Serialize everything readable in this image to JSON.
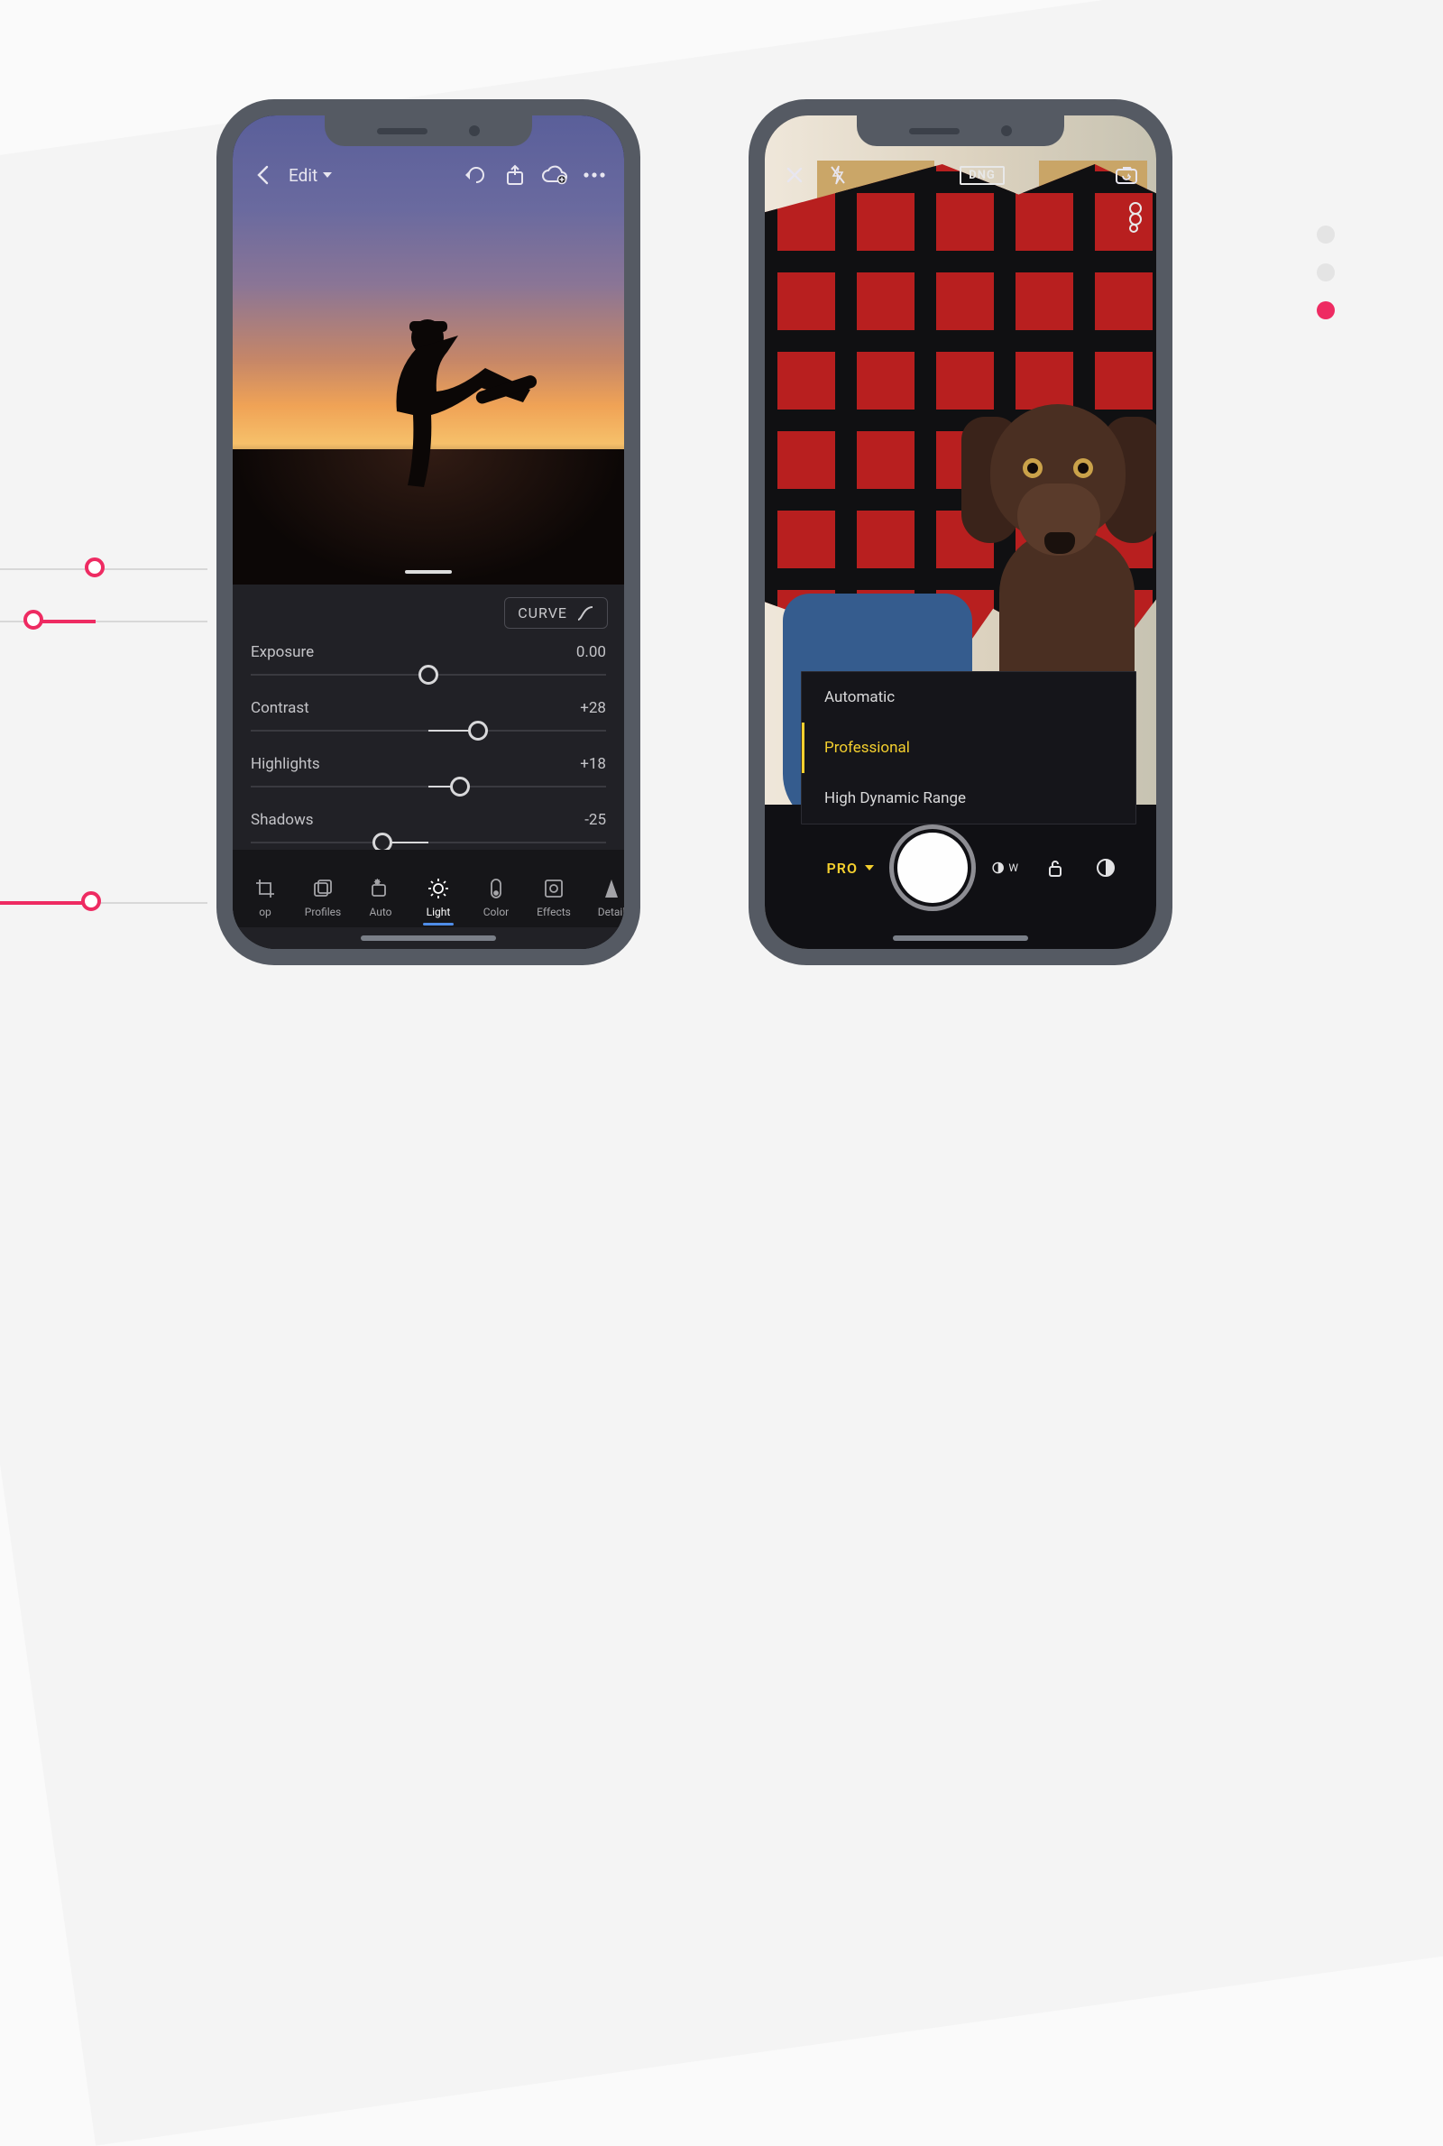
{
  "decoration": {
    "pager_dots": 3,
    "pager_active_index": 2
  },
  "editor": {
    "top": {
      "title": "Edit",
      "back_icon": "chevron-left",
      "actions": [
        "undo-icon",
        "share-icon",
        "cloud-add-icon",
        "more-icon"
      ]
    },
    "curve_button": "CURVE",
    "sliders": [
      {
        "label": "Exposure",
        "value_text": "0.00",
        "pos_pct": 50
      },
      {
        "label": "Contrast",
        "value_text": "+28",
        "pos_pct": 64
      },
      {
        "label": "Highlights",
        "value_text": "+18",
        "pos_pct": 59
      },
      {
        "label": "Shadows",
        "value_text": "-25",
        "pos_pct": 37
      }
    ],
    "tabs": [
      {
        "label": "Crop",
        "active": false
      },
      {
        "label": "Profiles",
        "active": false
      },
      {
        "label": "Auto",
        "active": false
      },
      {
        "label": "Light",
        "active": true
      },
      {
        "label": "Color",
        "active": false
      },
      {
        "label": "Effects",
        "active": false
      },
      {
        "label": "Detail",
        "active": false
      }
    ]
  },
  "camera": {
    "top": {
      "close_icon": "close",
      "flash_icon": "flash-off",
      "format_badge": "DNG",
      "switch_icon": "switch-camera"
    },
    "mode_menu": {
      "items": [
        "Automatic",
        "Professional",
        "High Dynamic Range"
      ],
      "selected_index": 1
    },
    "bottom": {
      "mode_label": "PRO",
      "wb_label": "W",
      "buttons": [
        "whitebalance-icon",
        "lock-unlocked-icon",
        "filters-icon"
      ]
    }
  }
}
